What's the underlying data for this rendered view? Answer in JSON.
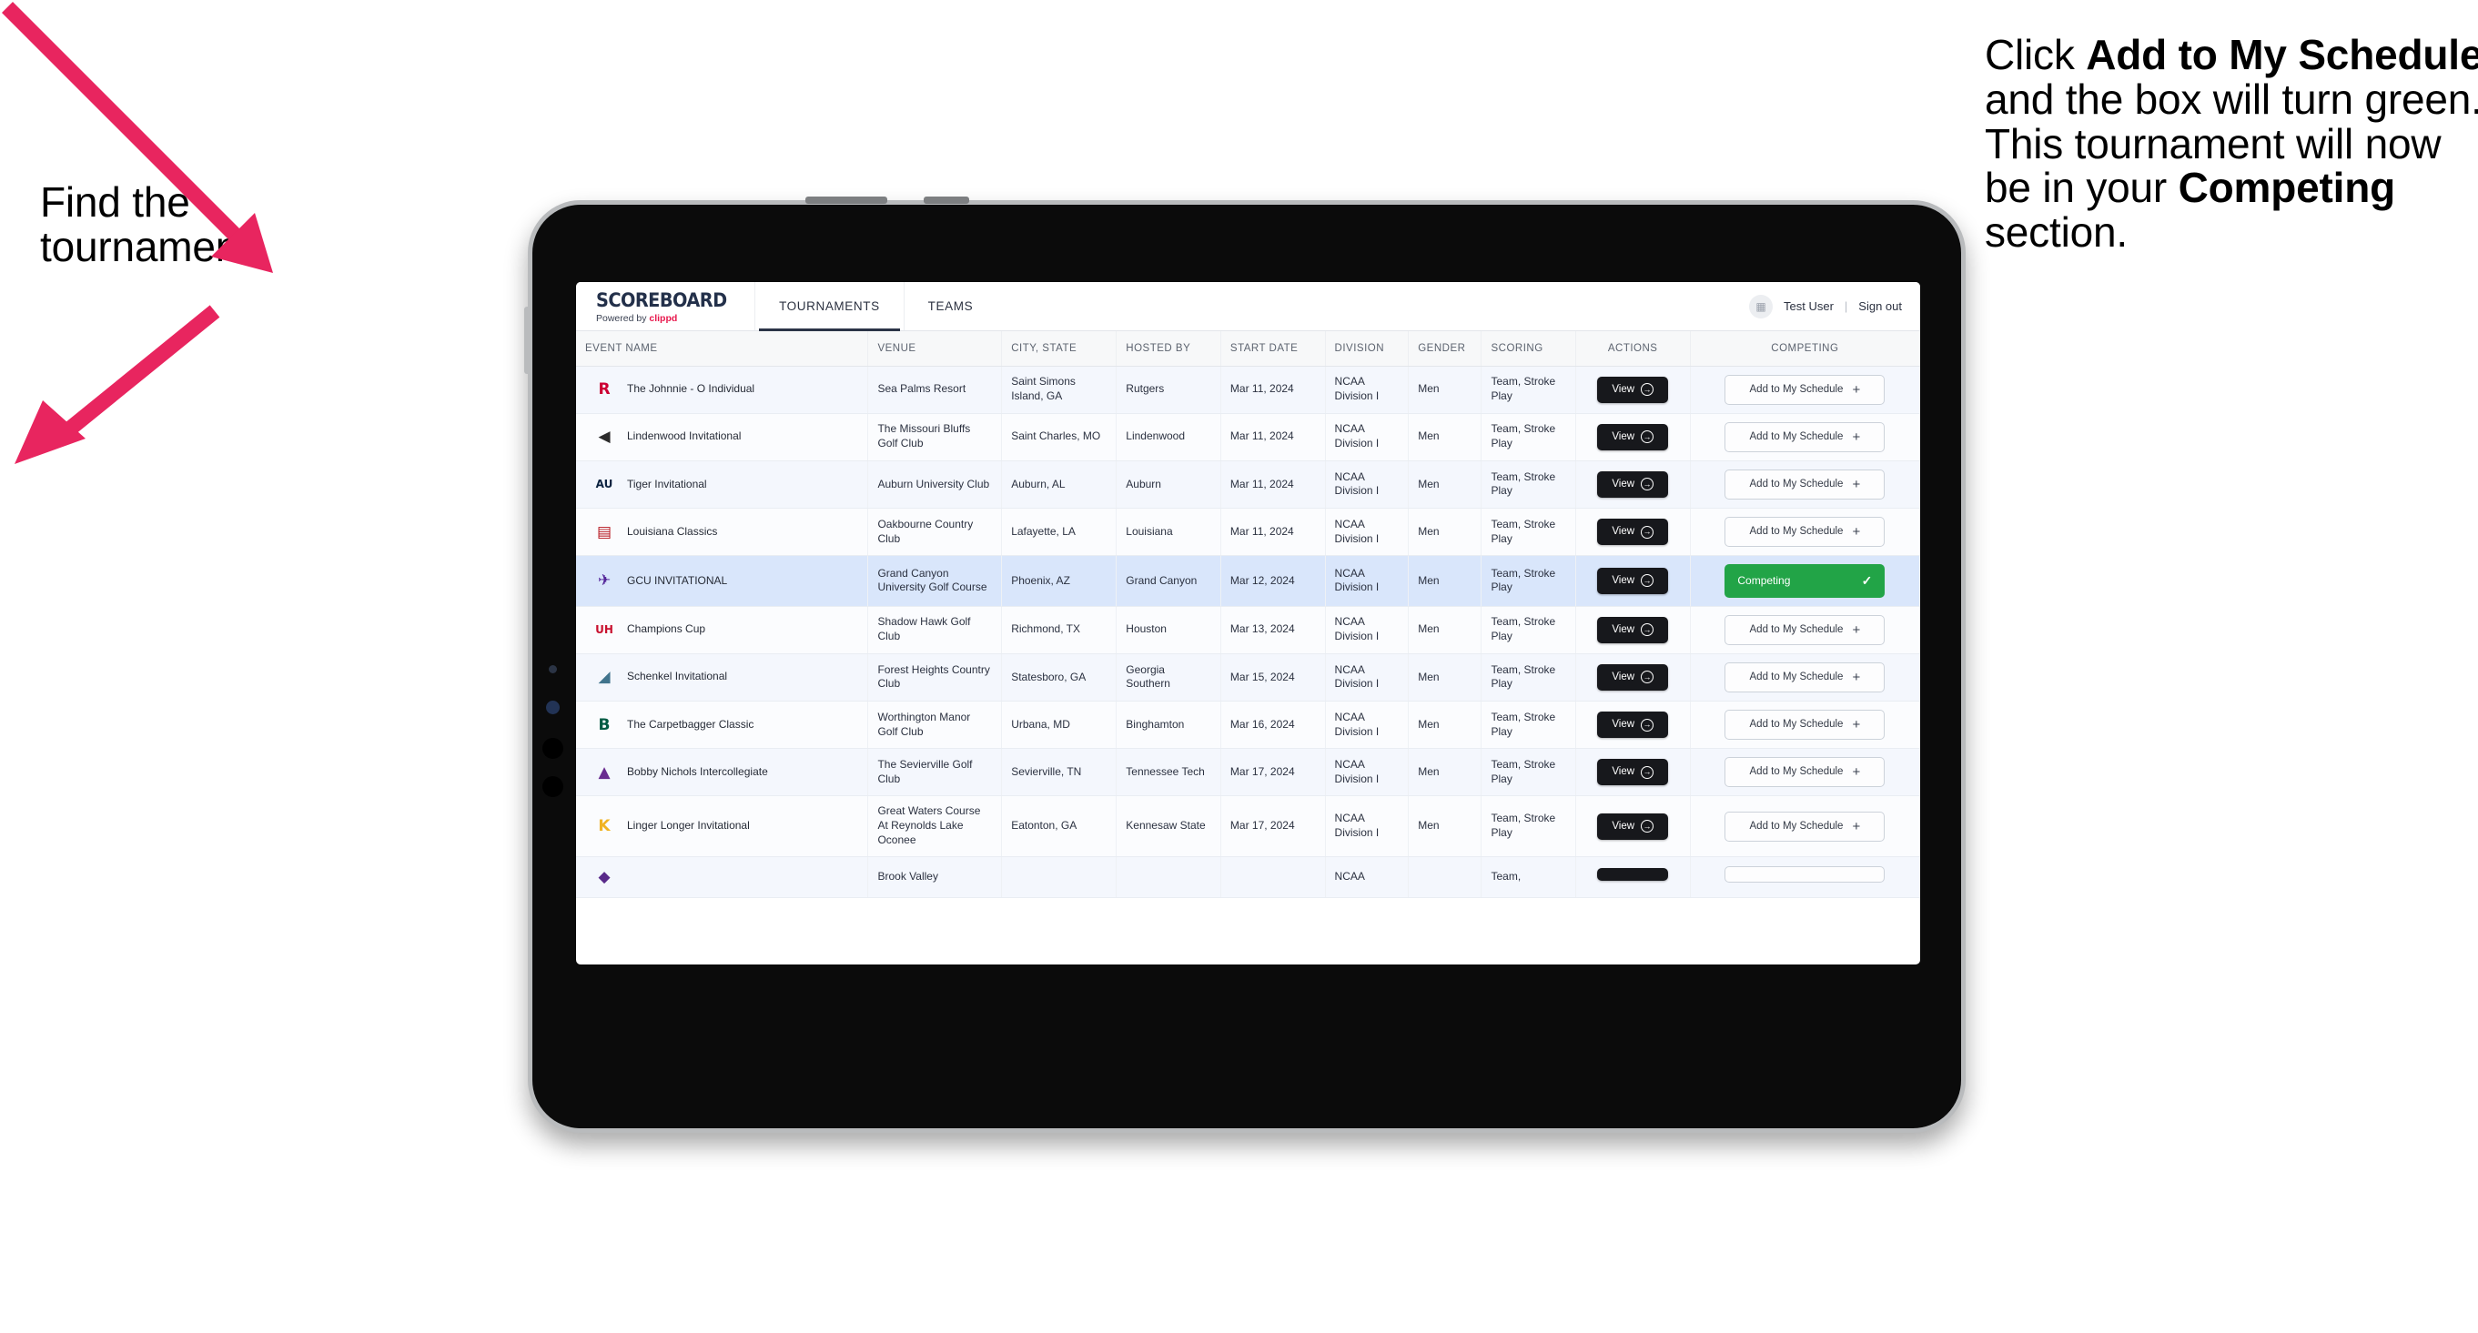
{
  "annotations": {
    "left": {
      "line1": "Find the",
      "line2": "tournament."
    },
    "right": {
      "part1": "Click ",
      "bold1": "Add to My Schedule",
      "part2": " and the box will turn green. This tournament will now be in your ",
      "bold2": "Competing",
      "part3": " section."
    },
    "arrow_color": "#e8255f"
  },
  "app": {
    "brand": {
      "title": "SCOREBOARD",
      "powered_prefix": "Powered by ",
      "powered_name": "clippd"
    },
    "tabs": [
      {
        "label": "TOURNAMENTS",
        "active": true
      },
      {
        "label": "TEAMS",
        "active": false
      }
    ],
    "account": {
      "avatar_icon": "grid-icon",
      "user": "Test User",
      "separator": "|",
      "signout": "Sign out"
    },
    "table": {
      "columns": [
        "EVENT NAME",
        "VENUE",
        "CITY, STATE",
        "HOSTED BY",
        "START DATE",
        "DIVISION",
        "GENDER",
        "SCORING",
        "ACTIONS",
        "COMPETING"
      ],
      "view_label": "View",
      "add_label": "Add to My Schedule",
      "competing_label": "Competing",
      "rows": [
        {
          "logo": "rutgers-logo",
          "event": "The Johnnie - O Individual",
          "venue": "Sea Palms Resort",
          "city": "Saint Simons Island, GA",
          "host": "Rutgers",
          "date": "Mar 11, 2024",
          "division": "NCAA Division I",
          "gender": "Men",
          "scoring": "Team, Stroke Play",
          "competing": false
        },
        {
          "logo": "lindenwood-logo",
          "event": "Lindenwood Invitational",
          "venue": "The Missouri Bluffs Golf Club",
          "city": "Saint Charles, MO",
          "host": "Lindenwood",
          "date": "Mar 11, 2024",
          "division": "NCAA Division I",
          "gender": "Men",
          "scoring": "Team, Stroke Play",
          "competing": false
        },
        {
          "logo": "auburn-logo",
          "event": "Tiger Invitational",
          "venue": "Auburn University Club",
          "city": "Auburn, AL",
          "host": "Auburn",
          "date": "Mar 11, 2024",
          "division": "NCAA Division I",
          "gender": "Men",
          "scoring": "Team, Stroke Play",
          "competing": false
        },
        {
          "logo": "louisiana-logo",
          "event": "Louisiana Classics",
          "venue": "Oakbourne Country Club",
          "city": "Lafayette, LA",
          "host": "Louisiana",
          "date": "Mar 11, 2024",
          "division": "NCAA Division I",
          "gender": "Men",
          "scoring": "Team, Stroke Play",
          "competing": false
        },
        {
          "logo": "gcu-logo",
          "event": "GCU INVITATIONAL",
          "venue": "Grand Canyon University Golf Course",
          "city": "Phoenix, AZ",
          "host": "Grand Canyon",
          "date": "Mar 12, 2024",
          "division": "NCAA Division I",
          "gender": "Men",
          "scoring": "Team, Stroke Play",
          "competing": true
        },
        {
          "logo": "houston-logo",
          "event": "Champions Cup",
          "venue": "Shadow Hawk Golf Club",
          "city": "Richmond, TX",
          "host": "Houston",
          "date": "Mar 13, 2024",
          "division": "NCAA Division I",
          "gender": "Men",
          "scoring": "Team, Stroke Play",
          "competing": false
        },
        {
          "logo": "georgia-southern-logo",
          "event": "Schenkel Invitational",
          "venue": "Forest Heights Country Club",
          "city": "Statesboro, GA",
          "host": "Georgia Southern",
          "date": "Mar 15, 2024",
          "division": "NCAA Division I",
          "gender": "Men",
          "scoring": "Team, Stroke Play",
          "competing": false
        },
        {
          "logo": "binghamton-logo",
          "event": "The Carpetbagger Classic",
          "venue": "Worthington Manor Golf Club",
          "city": "Urbana, MD",
          "host": "Binghamton",
          "date": "Mar 16, 2024",
          "division": "NCAA Division I",
          "gender": "Men",
          "scoring": "Team, Stroke Play",
          "competing": false
        },
        {
          "logo": "tennessee-tech-logo",
          "event": "Bobby Nichols Intercollegiate",
          "venue": "The Sevierville Golf Club",
          "city": "Sevierville, TN",
          "host": "Tennessee Tech",
          "date": "Mar 17, 2024",
          "division": "NCAA Division I",
          "gender": "Men",
          "scoring": "Team, Stroke Play",
          "competing": false
        },
        {
          "logo": "kennesaw-logo",
          "event": "Linger Longer Invitational",
          "venue": "Great Waters Course At Reynolds Lake Oconee",
          "city": "Eatonton, GA",
          "host": "Kennesaw State",
          "date": "Mar 17, 2024",
          "division": "NCAA Division I",
          "gender": "Men",
          "scoring": "Team, Stroke Play",
          "competing": false
        }
      ],
      "cutoff_row": {
        "logo": "ecu-logo",
        "venue": "Brook Valley",
        "division": "NCAA",
        "scoring": "Team,"
      }
    }
  }
}
